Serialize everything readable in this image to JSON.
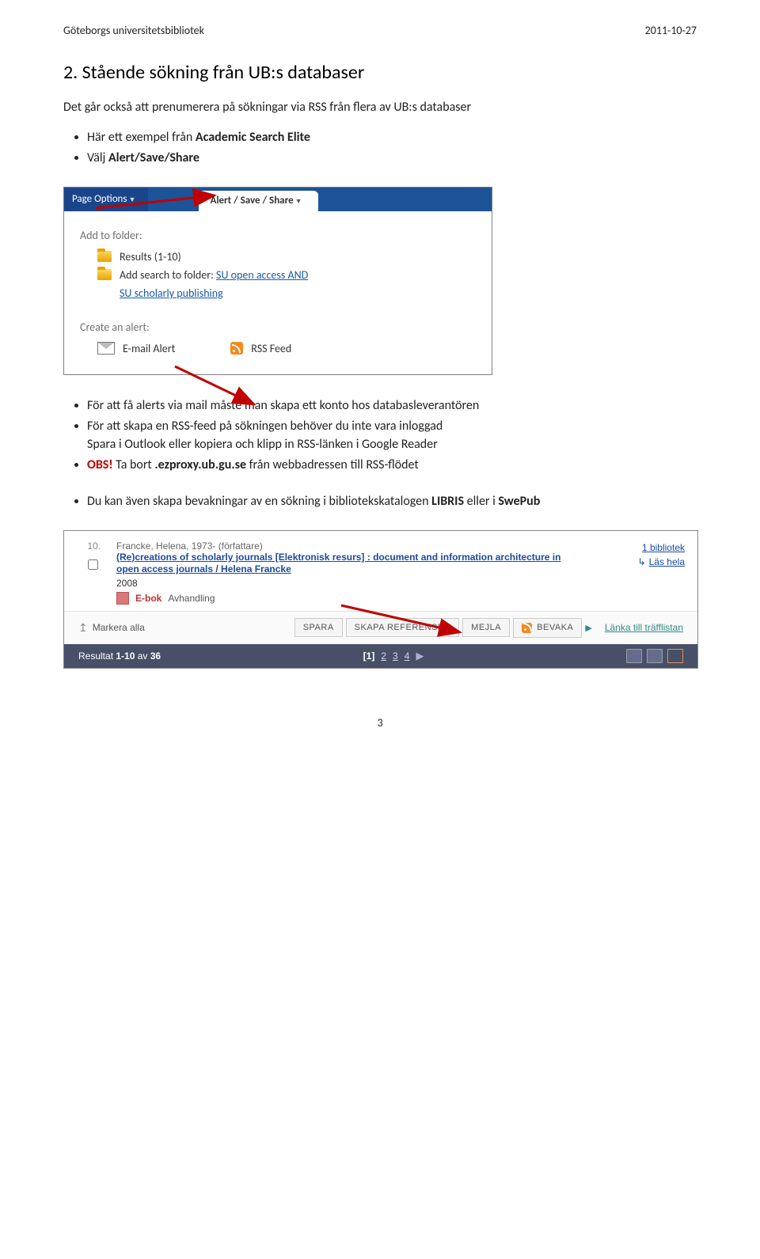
{
  "doc_header": {
    "left": "Göteborgs universitetsbibliotek",
    "right": "2011-10-27"
  },
  "section_title": "2. Stående sökning från UB:s databaser",
  "intro": "Det går också att prenumerera på sökningar via RSS från flera av UB:s databaser",
  "bullets1": {
    "i0_a": "Här ett exempel från ",
    "i0_b": "Academic Search Elite",
    "i1_a": "Välj ",
    "i1_b": "Alert/Save/Share"
  },
  "panel": {
    "tab_page_options": "Page Options",
    "tab_alert": "Alert / Save / Share",
    "add_to_folder": "Add to folder:",
    "results": "Results (1-10)",
    "add_search_a": "Add search to folder: ",
    "add_search_link": "SU open access AND",
    "add_search_2": "SU scholarly publishing",
    "create_alert": "Create an alert:",
    "email_alert": "E-mail Alert",
    "rss_feed": "RSS Feed"
  },
  "bullets2": {
    "i0": "För att få alerts via mail måste man skapa ett konto hos databasleverantören",
    "i1": "För att skapa en RSS-feed på sökningen behöver du inte vara inloggad\nSpara i Outlook eller kopiera och klipp in RSS-länken i Google Reader",
    "i2_obs": "OBS!",
    "i2_a": " Ta bort ",
    "i2_b": ".ezproxy.ub.gu.se",
    "i2_c": " från webbadressen till RSS-flödet"
  },
  "bullets3": {
    "i0_a": "Du kan även skapa bevakningar av en sökning i bibliotekskatalogen ",
    "i0_b": "LIBRIS",
    "i0_c": " eller i ",
    "i0_d": "SwePub"
  },
  "libris": {
    "num": "10.",
    "author": "Francke, Helena, 1973- (författare)",
    "title": "(Re)creations of scholarly journals [Elektronisk resurs] : document and information architecture in open access journals / Helena Francke",
    "year": "2008",
    "type_ebok": "E-bok",
    "type_avh": "Avhandling",
    "right_count": "1 bibliotek",
    "right_read": "Läs hela",
    "mark_all": "Markera alla",
    "btn_spara": "SPARA",
    "btn_ref": "SKAPA REFERENSER",
    "btn_mejla": "MEJLA",
    "btn_bevaka": "BEVAKA",
    "link_list": "Länka till träfflistan",
    "pager_a": "Resultat ",
    "pager_b": "1-10",
    "pager_c": " av ",
    "pager_d": "36",
    "p1": "1",
    "p2": "2",
    "p3": "3",
    "p4": "4"
  },
  "page_number": "3"
}
